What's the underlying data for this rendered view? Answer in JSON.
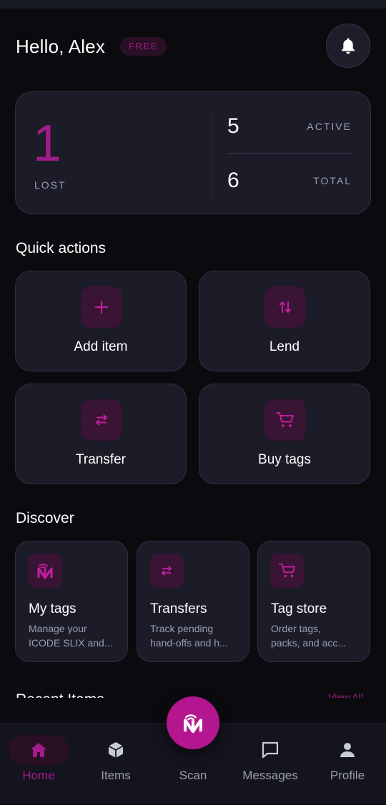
{
  "header": {
    "greeting": "Hello, Alex",
    "plan_badge": "FREE",
    "notifications_icon": "bell-icon"
  },
  "stats": {
    "lost": {
      "value": "1",
      "label": "LOST"
    },
    "active": {
      "value": "5",
      "label": "ACTIVE"
    },
    "total": {
      "value": "6",
      "label": "TOTAL"
    }
  },
  "quick_actions": {
    "title": "Quick actions",
    "items": [
      {
        "label": "Add item",
        "icon": "plus-icon"
      },
      {
        "label": "Lend",
        "icon": "swap-vertical-icon"
      },
      {
        "label": "Transfer",
        "icon": "swap-horizontal-icon"
      },
      {
        "label": "Buy tags",
        "icon": "cart-icon"
      }
    ]
  },
  "discover": {
    "title": "Discover",
    "cards": [
      {
        "title": "My tags",
        "desc_line1": "Manage your",
        "desc_line2": "ICODE SLIX and...",
        "icon": "nfc-logo-icon"
      },
      {
        "title": "Transfers",
        "desc_line1": "Track pending",
        "desc_line2": "hand-offs and h...",
        "icon": "swap-horizontal-icon"
      },
      {
        "title": "Tag store",
        "desc_line1": "Order tags,",
        "desc_line2": "packs, and acc...",
        "icon": "cart-icon"
      }
    ]
  },
  "recent": {
    "title": "Recent Items",
    "view_all": "View All"
  },
  "bottom_nav": {
    "items": [
      {
        "label": "Home",
        "icon": "home-icon",
        "active": true
      },
      {
        "label": "Items",
        "icon": "box-icon",
        "active": false
      },
      {
        "label": "Scan",
        "icon": "nfc-logo-icon",
        "active": false
      },
      {
        "label": "Messages",
        "icon": "chat-icon",
        "active": false
      },
      {
        "label": "Profile",
        "icon": "person-icon",
        "active": false
      }
    ]
  },
  "colors": {
    "accent": "#a11c8a",
    "fab": "#b3168e",
    "background": "#0b0b0f",
    "card": "#1b1c27",
    "muted_text": "#9c9eb0"
  }
}
